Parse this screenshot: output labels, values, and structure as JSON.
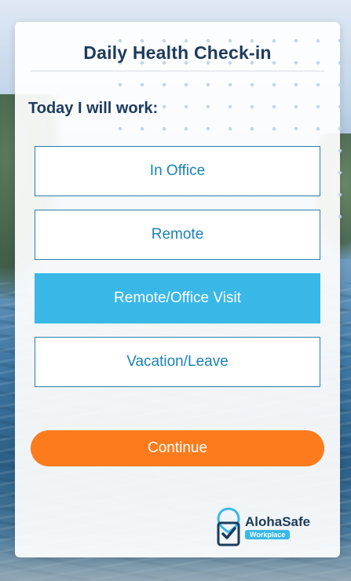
{
  "header": {
    "title": "Daily Health Check-in"
  },
  "question": {
    "prompt": "Today I will work:"
  },
  "options": [
    {
      "label": "In Office",
      "selected": false
    },
    {
      "label": "Remote",
      "selected": false
    },
    {
      "label": "Remote/Office Visit",
      "selected": true
    },
    {
      "label": "Vacation/Leave",
      "selected": false
    }
  ],
  "actions": {
    "continue_label": "Continue"
  },
  "brand": {
    "name": "AlohaSafe",
    "badge": "Workplace",
    "logo_icon": "location-pin-check-icon"
  },
  "colors": {
    "accent": "#39b8e8",
    "primary_text": "#1c3b5c",
    "option_text": "#1b82b5",
    "continue": "#fd7b1d"
  }
}
